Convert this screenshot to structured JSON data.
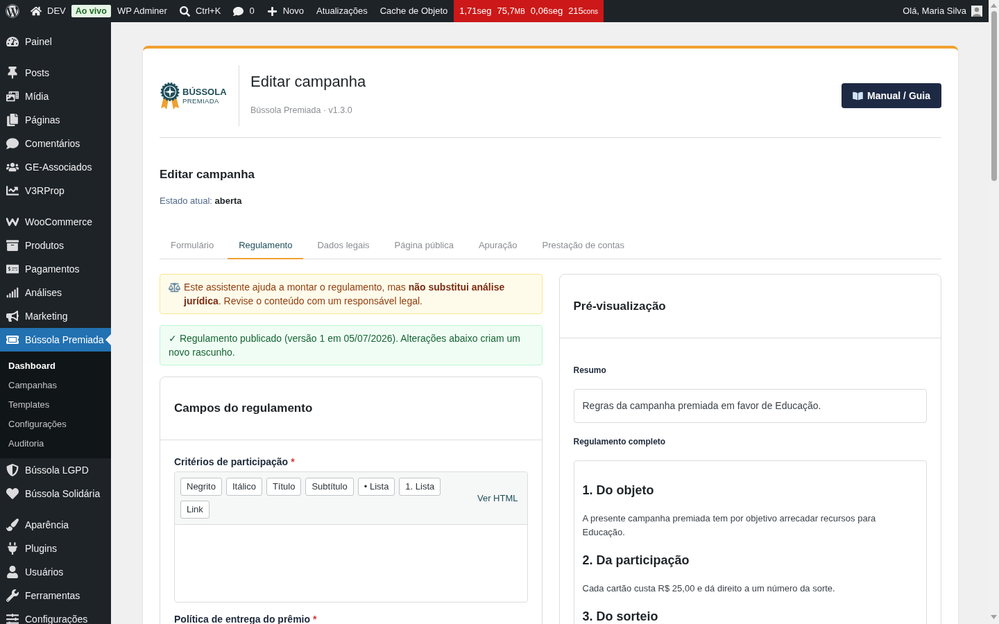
{
  "admin_bar": {
    "site": "DEV",
    "env_badge": "Ao vivo",
    "items": [
      {
        "kind": "link",
        "label": "WP Adminer"
      },
      {
        "kind": "search",
        "label": "Ctrl+K"
      },
      {
        "kind": "comments",
        "label": "0"
      },
      {
        "kind": "new",
        "label": "Novo"
      },
      {
        "kind": "link",
        "label": "Atualizações"
      },
      {
        "kind": "link",
        "label": "Cache de Objeto"
      }
    ],
    "stats": [
      {
        "text": "1,71seg"
      },
      {
        "text": "75,7",
        "unit": "MB"
      },
      {
        "text": "0,06seg"
      },
      {
        "text": "215",
        "unit": "cons"
      }
    ],
    "account": "Olá, Maria Silva"
  },
  "sidebar": {
    "sections": [
      {
        "items": [
          {
            "label": "Painel",
            "selected": false
          }
        ]
      },
      {
        "items": [
          {
            "label": "Posts",
            "selected": false
          },
          {
            "label": "Mídia",
            "selected": false
          },
          {
            "label": "Páginas",
            "selected": false
          },
          {
            "label": "Comentários",
            "selected": false
          },
          {
            "label": "GE-Associados",
            "selected": false
          },
          {
            "label": "V3RProp",
            "selected": false
          }
        ]
      },
      {
        "items": [
          {
            "label": "WooCommerce",
            "selected": false
          },
          {
            "label": "Produtos",
            "selected": false
          },
          {
            "label": "Pagamentos",
            "selected": false
          },
          {
            "label": "Análises",
            "selected": false
          },
          {
            "label": "Marketing",
            "selected": false
          },
          {
            "label": "Bússola Premiada",
            "selected": true,
            "children": [
              {
                "label": "Dashboard",
                "selected": true
              },
              {
                "label": "Campanhas",
                "selected": false
              },
              {
                "label": "Templates",
                "selected": false
              },
              {
                "label": "Configurações",
                "selected": false
              },
              {
                "label": "Auditoria",
                "selected": false
              }
            ]
          },
          {
            "label": "Bússola LGPD",
            "selected": false
          },
          {
            "label": "Bússola Solidária",
            "selected": false
          }
        ]
      },
      {
        "items": [
          {
            "label": "Aparência",
            "selected": false
          },
          {
            "label": "Plugins",
            "selected": false
          },
          {
            "label": "Usuários",
            "selected": false
          },
          {
            "label": "Ferramentas",
            "selected": false
          },
          {
            "label": "Configurações",
            "selected": false
          }
        ]
      }
    ]
  },
  "header": {
    "logo": {
      "name": "BÚSSOLA",
      "tagline": "PREMIADA"
    },
    "title": "Editar campanha",
    "subtitle": "Bússola Premiada · v1.3.0",
    "button": "Manual / Guia"
  },
  "section": {
    "title": "Editar campanha",
    "status": "Estado atual: **aberta**"
  },
  "tabs": [
    {
      "label": "Formulário",
      "selected": false
    },
    {
      "label": "Regulamento",
      "selected": true
    },
    {
      "label": "Dados legais",
      "selected": false
    },
    {
      "label": "Página pública",
      "selected": false
    },
    {
      "label": "Apuração",
      "selected": false
    },
    {
      "label": "Prestação de contas",
      "selected": false
    }
  ],
  "notices": [
    {
      "kind": "warning",
      "text": "Este assistente ajuda a montar o regulamento, mas **não substitui análise jurídica**. Revise o conteúdo com um responsável legal."
    },
    {
      "kind": "success",
      "text": "✓ Regulamento publicado (versão 1 em 05/07/2026). Alterações abaixo criam um novo rascunho."
    }
  ],
  "fields_panel": {
    "title": "Campos do regulamento",
    "fields": [
      {
        "label": "Critérios de participação",
        "required_mark": "*",
        "toolbar": [
          "Negrito",
          "Itálico",
          "Título",
          "Subtítulo",
          "• Lista",
          "1. Lista",
          "Link"
        ],
        "html_link": "Ver HTML"
      },
      {
        "label": "Política de entrega do prêmio",
        "required_mark": "*"
      }
    ]
  },
  "preview": {
    "title": "Pré-visualização",
    "summary_label": "Resumo",
    "summary": "Regras da campanha premiada em favor de Educação.",
    "full_label": "Regulamento completo",
    "sections": [
      {
        "heading": "1. Do objeto",
        "text": "A presente campanha premiada tem por objetivo arrecadar recursos para Educação."
      },
      {
        "heading": "2. Da participação",
        "text": "Cada cartão custa R$ 25,00 e dá direito a um número da sorte."
      },
      {
        "heading": "3. Do sorteio"
      }
    ]
  }
}
